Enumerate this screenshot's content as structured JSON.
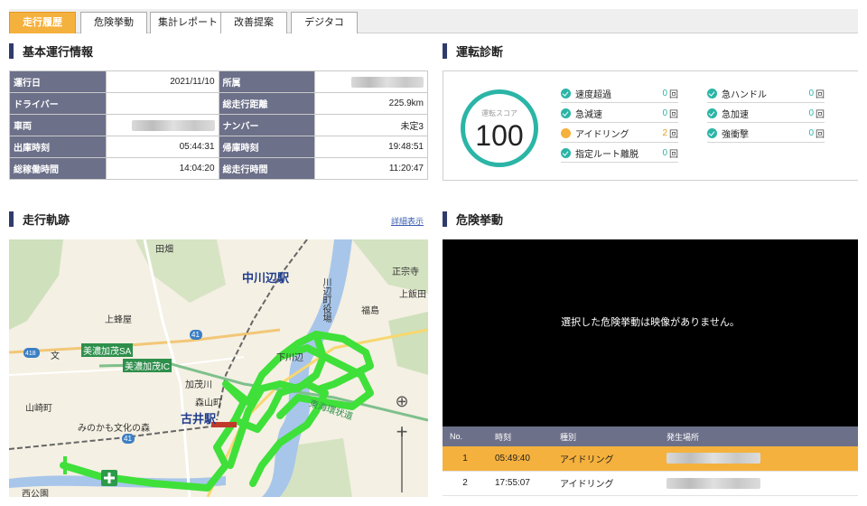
{
  "tabs": [
    {
      "label": "走行履歴",
      "active": true
    },
    {
      "label": "危険挙動",
      "active": false
    },
    {
      "label": "集計レポート",
      "active": false
    },
    {
      "label": "改善提案",
      "active": false
    },
    {
      "label": "デジタコ",
      "active": false
    }
  ],
  "basic_info": {
    "title": "基本運行情報",
    "rows": [
      {
        "l1": "運行日",
        "v1": "2021/11/10",
        "l2": "所属",
        "v2": ""
      },
      {
        "l1": "ドライバー",
        "v1": "",
        "l2": "総走行距離",
        "v2": "225.9km"
      },
      {
        "l1": "車両",
        "v1": "",
        "l2": "ナンバー",
        "v2": "未定3"
      },
      {
        "l1": "出庫時刻",
        "v1": "05:44:31",
        "l2": "帰庫時刻",
        "v2": "19:48:51"
      },
      {
        "l1": "総稼働時間",
        "v1": "14:04:20",
        "l2": "総走行時間",
        "v2": "11:20:47"
      }
    ]
  },
  "diagnosis": {
    "title": "運転診断",
    "score_label": "運転スコア",
    "score": "100",
    "items_left": [
      {
        "name": "速度超過",
        "count": "0",
        "unit": "回",
        "status": "ok"
      },
      {
        "name": "急減速",
        "count": "0",
        "unit": "回",
        "status": "ok"
      },
      {
        "name": "アイドリング",
        "count": "2",
        "unit": "回",
        "status": "warn"
      },
      {
        "name": "指定ルート離脱",
        "count": "0",
        "unit": "回",
        "status": "ok"
      }
    ],
    "items_right": [
      {
        "name": "急ハンドル",
        "count": "0",
        "unit": "回",
        "status": "ok"
      },
      {
        "name": "急加速",
        "count": "0",
        "unit": "回",
        "status": "ok"
      },
      {
        "name": "強衝撃",
        "count": "0",
        "unit": "回",
        "status": "ok"
      }
    ]
  },
  "track": {
    "title": "走行軌跡",
    "detail_link": "詳細表示",
    "map_labels": [
      "田畑",
      "中川辺駅",
      "川辺町役場",
      "正宗寺",
      "上飯田",
      "上蜂屋",
      "福島",
      "下川辺",
      "美濃加茂SA",
      "美濃加茂IC",
      "加茂川",
      "森山町",
      "古井駅",
      "東海環状道",
      "山崎町",
      "みのかも文化の森",
      "西公園",
      "文"
    ],
    "route_numbers": [
      "418",
      "41",
      "41"
    ]
  },
  "danger": {
    "title": "危険挙動",
    "no_video": "選択した危険挙動は映像がありません。",
    "columns": [
      "No.",
      "時刻",
      "種別",
      "発生場所"
    ],
    "rows": [
      {
        "no": "1",
        "time": "05:49:40",
        "type": "アイドリング",
        "selected": true
      },
      {
        "no": "2",
        "time": "17:55:07",
        "type": "アイドリング",
        "selected": false
      }
    ]
  },
  "colors": {
    "accent": "#f5b13d",
    "header": "#6c7089",
    "teal": "#2bb5a6",
    "route": "#3fe03a",
    "title_bar": "#2f3c6b"
  }
}
